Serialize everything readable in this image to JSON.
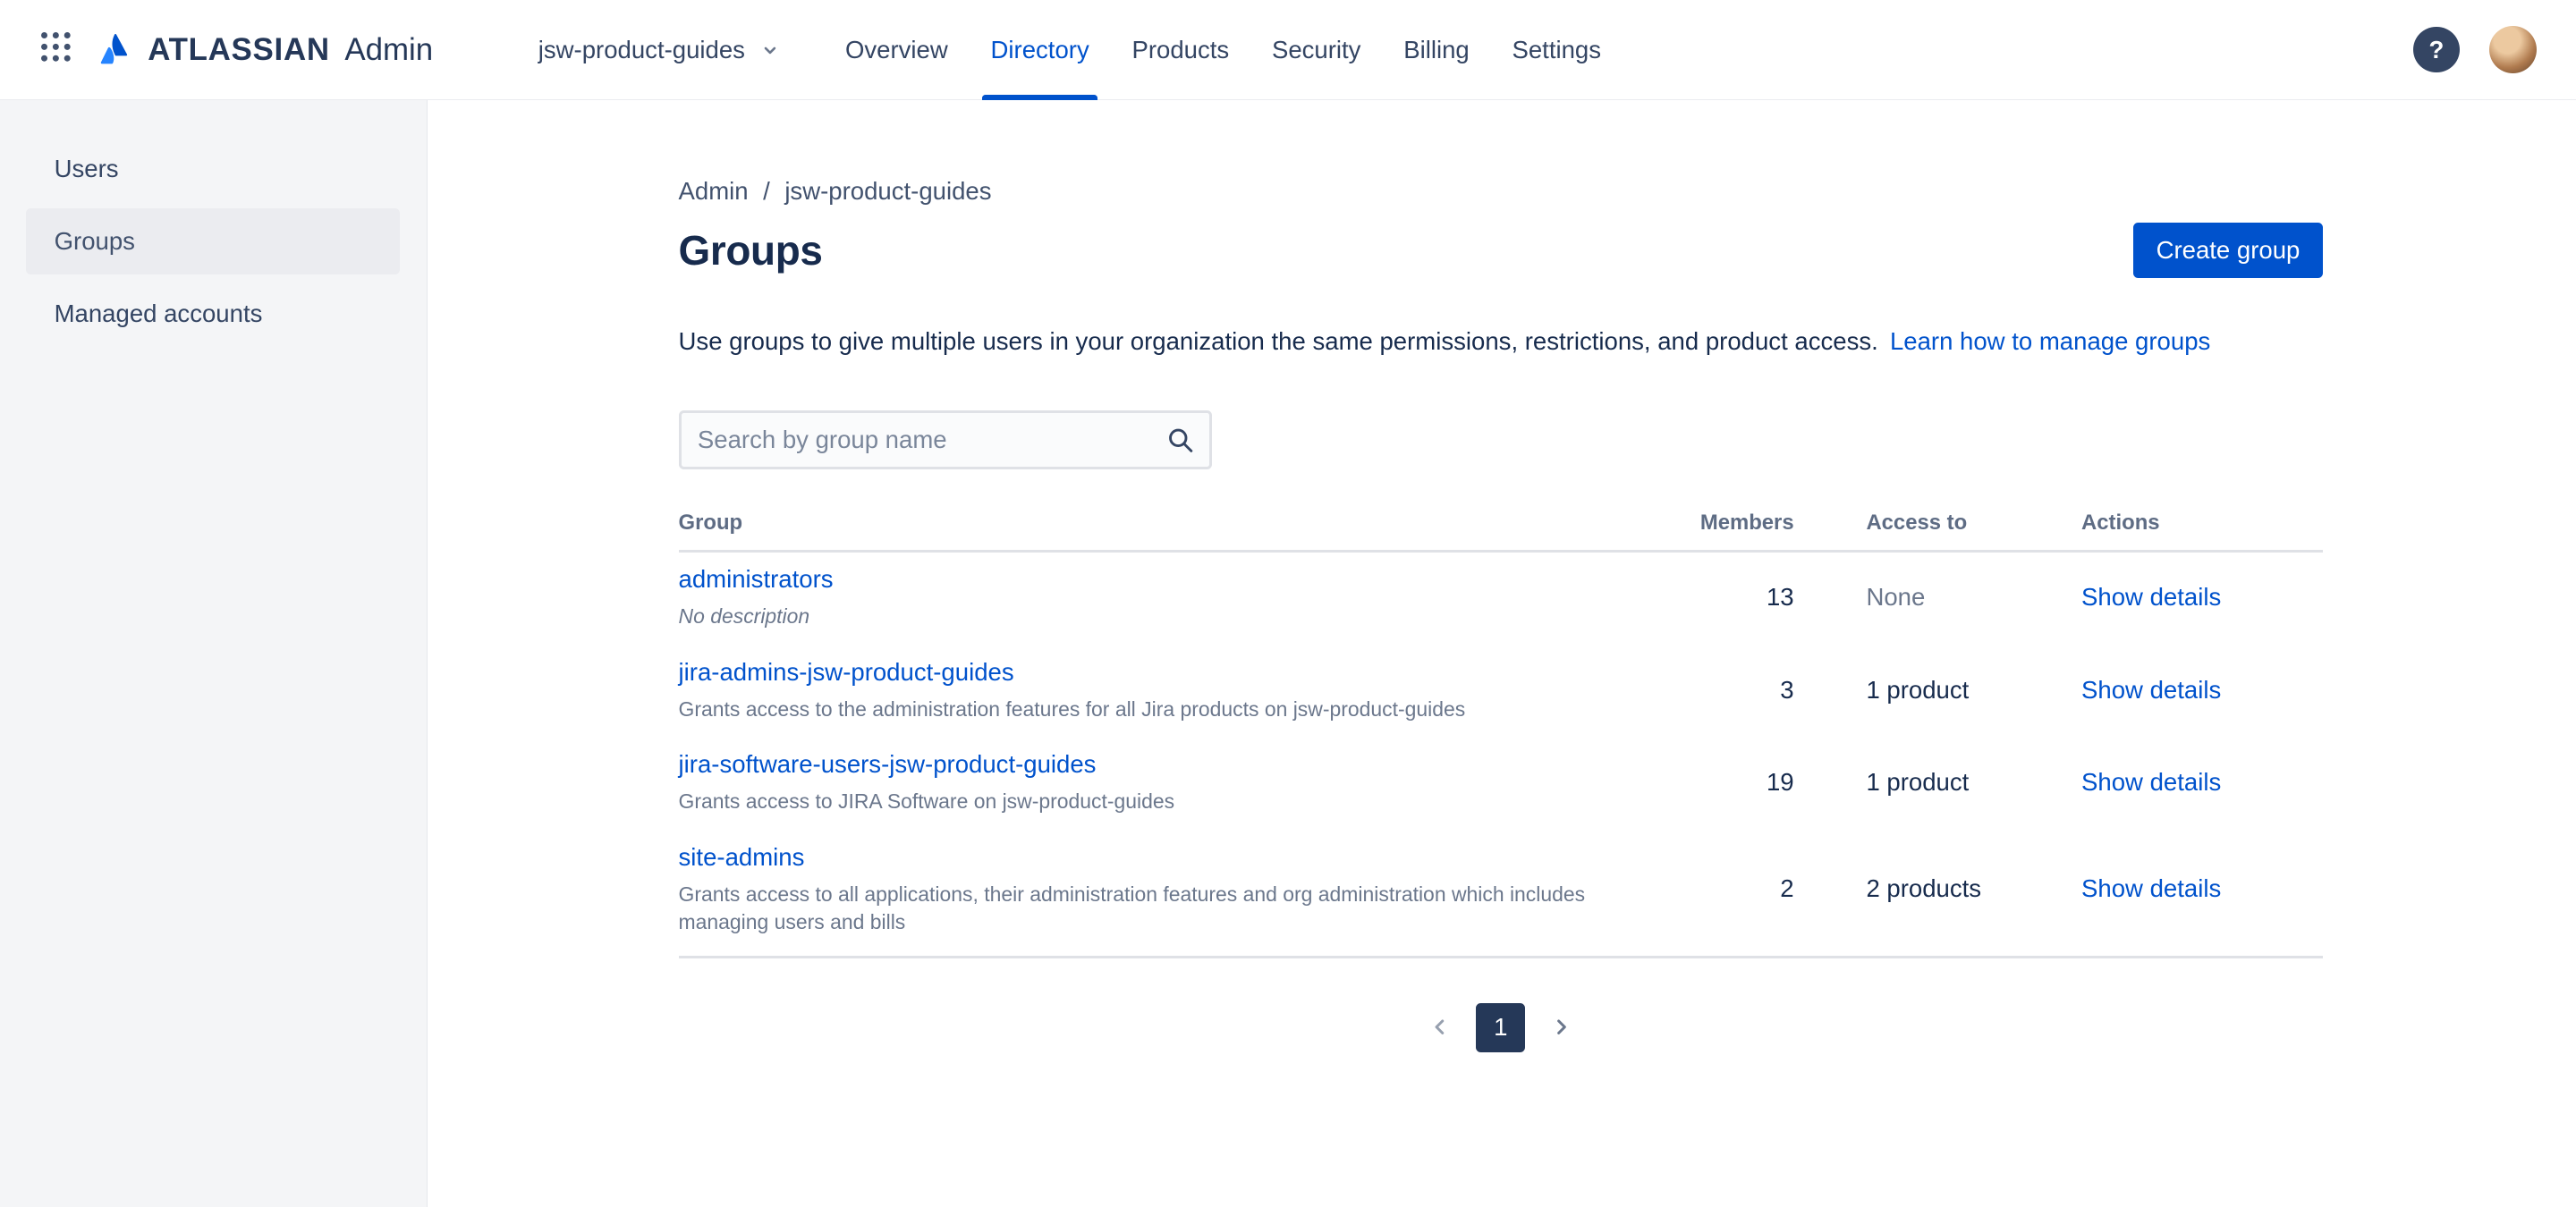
{
  "topbar": {
    "brand": {
      "name": "ATLASSIAN",
      "product": "Admin"
    },
    "org_switcher": {
      "label": "jsw-product-guides"
    },
    "nav": [
      {
        "label": "Overview",
        "active": false
      },
      {
        "label": "Directory",
        "active": true
      },
      {
        "label": "Products",
        "active": false
      },
      {
        "label": "Security",
        "active": false
      },
      {
        "label": "Billing",
        "active": false
      },
      {
        "label": "Settings",
        "active": false
      }
    ],
    "help_label": "?"
  },
  "sidebar": {
    "items": [
      {
        "label": "Users",
        "active": false
      },
      {
        "label": "Groups",
        "active": true
      },
      {
        "label": "Managed accounts",
        "active": false
      }
    ]
  },
  "main": {
    "breadcrumb": {
      "items": [
        "Admin",
        "jsw-product-guides"
      ],
      "separator": "/"
    },
    "title": "Groups",
    "create_button": "Create group",
    "intro": {
      "text": "Use groups to give multiple users in your organization the same permissions, restrictions, and product access.",
      "link": "Learn how to manage groups"
    },
    "search": {
      "placeholder": "Search by group name"
    },
    "table": {
      "headers": {
        "group": "Group",
        "members": "Members",
        "access": "Access to",
        "actions": "Actions"
      },
      "rows": [
        {
          "name": "administrators",
          "description": "No description",
          "members": "13",
          "access": "None",
          "action": "Show details"
        },
        {
          "name": "jira-admins-jsw-product-guides",
          "description": "Grants access to the administration features for all Jira products on jsw-product-guides",
          "members": "3",
          "access": "1 product",
          "action": "Show details"
        },
        {
          "name": "jira-software-users-jsw-product-guides",
          "description": "Grants access to JIRA Software on jsw-product-guides",
          "members": "19",
          "access": "1 product",
          "action": "Show details"
        },
        {
          "name": "site-admins",
          "description": "Grants access to all applications, their administration features and org administration which includes managing users and bills",
          "members": "2",
          "access": "2 products",
          "action": "Show details"
        }
      ]
    },
    "pagination": {
      "page": "1"
    }
  },
  "icons": {
    "app_switcher": "grid-icon",
    "brand_mark": "atlassian-logo",
    "org_caret": "chevron-down-icon",
    "help": "question-mark-icon",
    "search": "magnifier-icon",
    "pagination_prev": "chevron-left-icon",
    "pagination_next": "chevron-right-icon"
  },
  "colors": {
    "accent_blue": "#0052CC",
    "navy_text": "#172B4D",
    "muted_text": "#6B778C",
    "sidebar_bg": "#F4F5F7",
    "active_item_bg": "#EBECF0",
    "pagination_dark": "#253858"
  }
}
